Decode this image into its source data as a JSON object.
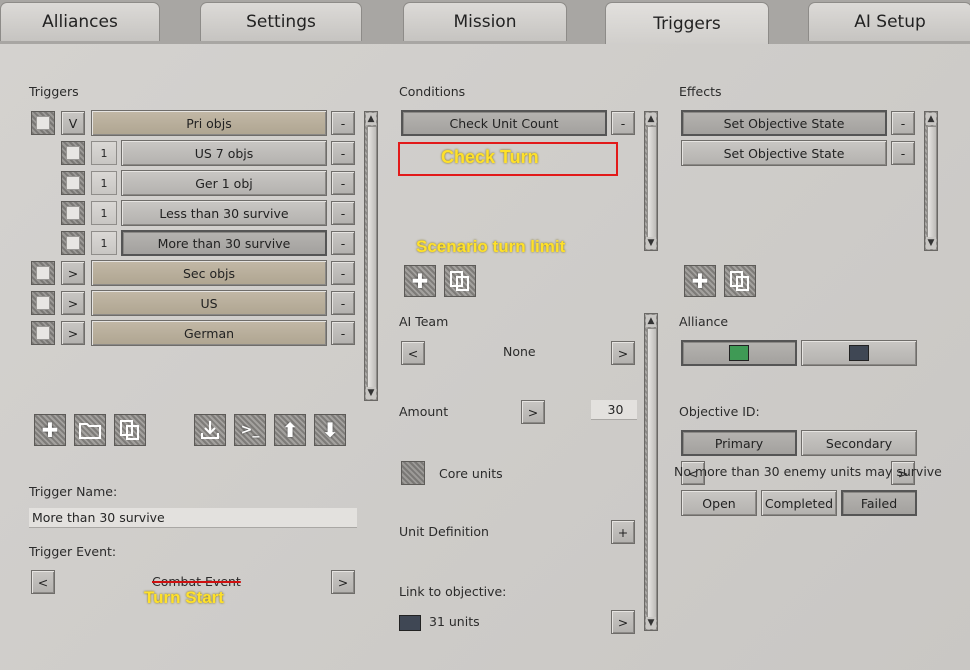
{
  "tabs": [
    "Alliances",
    "Settings",
    "Mission",
    "Triggers",
    "AI Setup"
  ],
  "triggers": {
    "heading": "Triggers",
    "items": [
      {
        "toggle": "V",
        "label": "Pri objs",
        "indent": 0
      },
      {
        "count": "1",
        "label": "US 7 objs",
        "indent": 1
      },
      {
        "count": "1",
        "label": "Ger 1 obj",
        "indent": 1
      },
      {
        "count": "1",
        "label": "Less than 30 survive",
        "indent": 1
      },
      {
        "count": "1",
        "label": "More than 30 survive",
        "indent": 1,
        "selected": true
      },
      {
        "toggle": ">",
        "label": "Sec objs",
        "indent": 0
      },
      {
        "toggle": ">",
        "label": "US",
        "indent": 0
      },
      {
        "toggle": ">",
        "label": "German",
        "indent": 0
      }
    ],
    "remove_label": "-",
    "name_label": "Trigger Name:",
    "name_value": "More than 30 survive",
    "event_label": "Trigger Event:",
    "event_value": "Combat Event",
    "prev": "<",
    "next": ">"
  },
  "conditions": {
    "heading": "Conditions",
    "item": "Check Unit Count",
    "remove_label": "-",
    "ai_team_label": "AI Team",
    "ai_team_value": "None",
    "prev": "<",
    "next": ">",
    "amount_label": "Amount",
    "amount_value": "30",
    "core_units_label": "Core units",
    "unit_def_label": "Unit Definition",
    "plus": "+",
    "link_label": "Link to objective:",
    "link_value": "31 units"
  },
  "effects": {
    "heading": "Effects",
    "items": [
      "Set Objective State",
      "Set Objective State"
    ],
    "remove_label": "-",
    "alliance_label": "Alliance",
    "alliance_colors": [
      "#3f9a55",
      "#3f4754"
    ],
    "objective_label": "Objective ID:",
    "obj_types": [
      "Primary",
      "Secondary"
    ],
    "objective_desc": "No more than 30 enemy units may survive",
    "states": [
      "Open",
      "Completed",
      "Failed"
    ]
  },
  "annotations": {
    "check_turn": "Check Turn",
    "scenario_limit": "Scenario turn limit",
    "turn_start": "Turn Start"
  },
  "colors": {
    "annotation": "#ffe12a",
    "highlight": "#e21a1a"
  }
}
